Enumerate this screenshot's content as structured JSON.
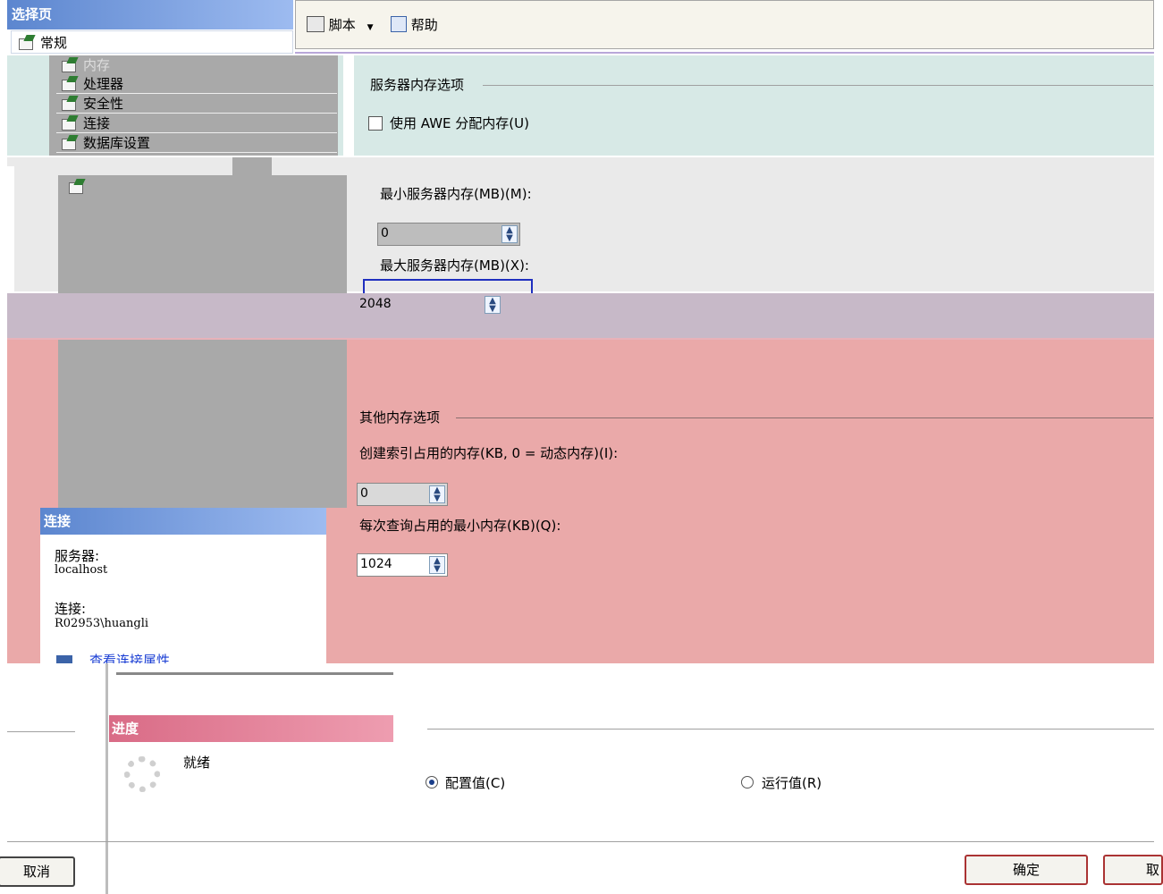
{
  "select_page": {
    "header": "选择页",
    "items": [
      "常规",
      "内存",
      "处理器",
      "安全性",
      "连接",
      "数据库设置"
    ]
  },
  "toolbar": {
    "script_label": "脚本",
    "help_label": "帮助"
  },
  "memory": {
    "group_title": "服务器内存选项",
    "awe_label": "使用 AWE 分配内存(U)",
    "awe_checked": false,
    "min_label": "最小服务器内存(MB)(M):",
    "min_value": "0",
    "max_label": "最大服务器内存(MB)(X):",
    "max_value": "2048"
  },
  "other_memory": {
    "group_title": "其他内存选项",
    "index_label": "创建索引占用的内存(KB, 0 = 动态内存)(I):",
    "index_value": "0",
    "query_label": "每次查询占用的最小内存(KB)(Q):",
    "query_value": "1024"
  },
  "connection": {
    "header": "连接",
    "server_label": "服务器:",
    "server_value": "localhost",
    "conn_label": "连接:",
    "conn_value": "R02953\\huangli",
    "view_link": "查看连接属性"
  },
  "progress": {
    "header": "进度",
    "status": "就绪"
  },
  "radios": {
    "configured": "配置值(C)",
    "running": "运行值(R)",
    "selected": "configured"
  },
  "buttons": {
    "cancel": "取消",
    "ok": "确定",
    "cancel_right": "取"
  }
}
